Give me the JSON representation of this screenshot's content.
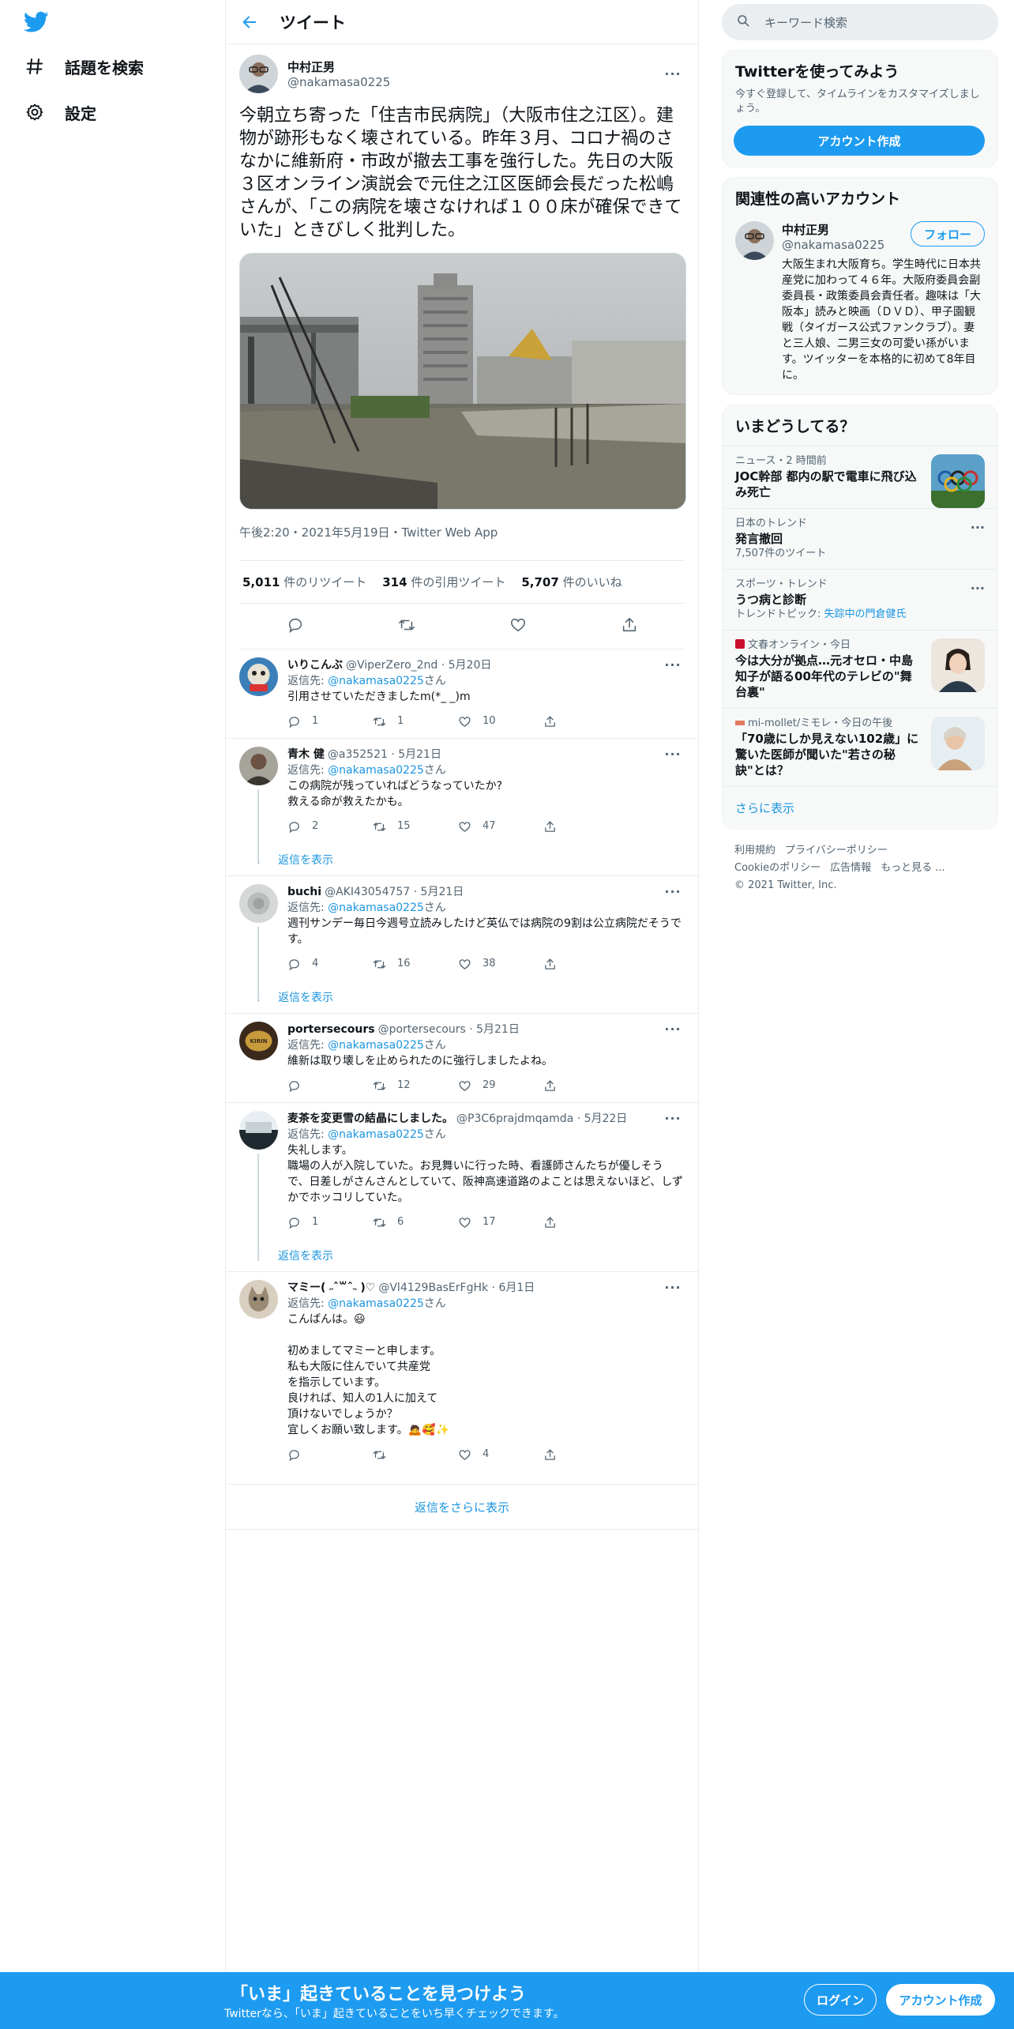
{
  "nav": {
    "items": [
      {
        "label": "話題を検索",
        "icon": "hashtag-icon"
      },
      {
        "label": "設定",
        "icon": "gear-icon"
      }
    ]
  },
  "header": {
    "title": "ツイート"
  },
  "main_tweet": {
    "name": "中村正男",
    "handle": "@nakamasa0225",
    "text": "今朝立ち寄った「住吉市民病院」（大阪市住之江区）。建物が跡形もなく壊されている。昨年３月、コロナ禍のさなかに維新府・市政が撤去工事を強行した。先日の大阪３区オンライン演説会で元住之江区医師会長だった松嶋さんが、「この病院を壊さなければ１００床が確保できていた」ときびしく批判した。",
    "meta": "午後2:20・2021年5月19日・Twitter Web App",
    "retweets": "5,011",
    "retweets_label": "件のリツイート",
    "quotes": "314",
    "quotes_label": "件の引用ツイート",
    "likes": "5,707",
    "likes_label": "件のいいね"
  },
  "replies": [
    {
      "name": "いりこんぶ",
      "handle": "@ViperZero_2nd · 5月20日",
      "to_prefix": "返信先: ",
      "to": "@nakamasa0225",
      "to_suffix": "さん",
      "text": "引用させていただきましたm(*_ _)m",
      "reply": "1",
      "rt": "1",
      "like": "10"
    },
    {
      "name": "青木 健",
      "handle": "@a352521 · 5月21日",
      "to_prefix": "返信先: ",
      "to": "@nakamasa0225",
      "to_suffix": "さん",
      "text": "この病院が残っていればどうなっていたか?\n救える命が救えたかも。",
      "reply": "2",
      "rt": "15",
      "like": "47"
    },
    {
      "name": "buchi",
      "handle": "@AKI43054757 · 5月21日",
      "to_prefix": "返信先: ",
      "to": "@nakamasa0225",
      "to_suffix": "さん",
      "text": "週刊サンデー毎日今週号立読みしたけど英仏では病院の9割は公立病院だそうです。",
      "reply": "4",
      "rt": "16",
      "like": "38"
    },
    {
      "name": "portersecours",
      "handle": "@portersecours · 5月21日",
      "to_prefix": "返信先: ",
      "to": "@nakamasa0225",
      "to_suffix": "さん",
      "text": "維新は取り壊しを止められたのに強行しましたよね。",
      "reply": "",
      "rt": "12",
      "like": "29"
    },
    {
      "name": "麦茶を変更雪の結晶にしました。",
      "handle": "@P3C6prajdmqamda · 5月22日",
      "to_prefix": "返信先: ",
      "to": "@nakamasa0225",
      "to_suffix": "さん",
      "text": "失礼します。\n職場の人が入院していた。お見舞いに行った時、看護師さんたちが優しそうで、日差しがさんさんとしていて、阪神高速道路のよことは思えないほど、しずかでホッコリしていた。",
      "reply": "1",
      "rt": "6",
      "like": "17"
    },
    {
      "name": "マミー( ˶ˆ꒳ˆ˵ )♡",
      "handle": "@Vl4129BasErFgHk · 6月1日",
      "to_prefix": "返信先: ",
      "to": "@nakamasa0225",
      "to_suffix": "さん",
      "text": "こんばんは。😃\n\n初めましてマミーと申します。\n私も大阪に住んでいて共産党\nを指示しています。\n良ければ、知人の1人に加えて\n頂けないでしょうか？\n宜しくお願い致します。🙇🥰✨",
      "reply": "",
      "rt": "",
      "like": "4"
    }
  ],
  "show_replies_label": "返信を表示",
  "more_replies_label": "返信をさらに表示",
  "search": {
    "placeholder": "キーワード検索"
  },
  "signup_card": {
    "title": "Twitterを使ってみよう",
    "sub": "今すぐ登録して、タイムラインをカスタマイズしましょう。",
    "button": "アカウント作成"
  },
  "related": {
    "title": "関連性の高いアカウント",
    "name": "中村正男",
    "handle": "@nakamasa0225",
    "follow": "フォロー",
    "bio": "大阪生まれ大阪育ち。学生時代に日本共産党に加わって４６年。大阪府委員会副委員長・政策委員会責任者。趣味は「大阪本」読みと映画（ＤＶＤ）、甲子園観戦（タイガース公式ファンクラブ）。妻と三人娘、二男三女の可愛い孫がいます。ツイッターを本格的に初めて8年目に。"
  },
  "trends": {
    "title": "いまどうしてる？",
    "items": [
      {
        "meta": "ニュース・2 時間前",
        "title": "JOC幹部 都内の駅で電車に飛び込み死亡",
        "sub": "",
        "sub_link": ""
      },
      {
        "meta": "日本のトレンド",
        "title": "発言撤回",
        "sub": "7,507件のツイート",
        "sub_link": ""
      },
      {
        "meta": "スポーツ・トレンド",
        "title": "うつ病と診断",
        "sub": "トレンドトピック: ",
        "sub_link": "失踪中の門倉健氏"
      },
      {
        "meta": "文春オンライン・今日",
        "title": "今は大分が拠点…元オセロ・中島知子が語る00年代のテレビの\"舞台裏\"",
        "sub": "",
        "sub_link": ""
      },
      {
        "meta": "mi-mollet/ミモレ・今日の午後",
        "title": "「70歳にしか見えない102歳」に驚いた医師が聞いた\"若さの秘訣\"とは？",
        "sub": "",
        "sub_link": ""
      }
    ],
    "show_more": "さらに表示"
  },
  "footer": {
    "terms": "利用規約",
    "privacy": "プライバシーポリシー",
    "cookie": "Cookieのポリシー",
    "ads": "広告情報",
    "more": "もっと見る ...",
    "copyright": "© 2021 Twitter, Inc."
  },
  "bottom_bar": {
    "title": "「いま」起きていることを見つけよう",
    "sub": "Twitterなら、「いま」起きていることをいち早くチェックできます。",
    "login": "ログイン",
    "signup": "アカウント作成"
  },
  "colors": {
    "accent": "#1d9bf0",
    "link": "#1b95e0",
    "text": "#0f1419",
    "muted": "#536471"
  }
}
